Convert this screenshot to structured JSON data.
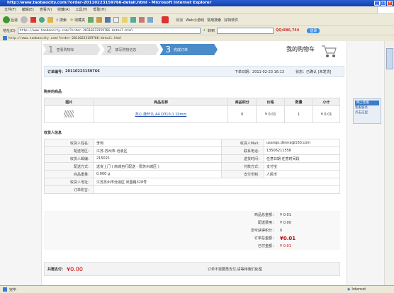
{
  "window": {
    "title": "http://www.taobaocity.com/?order-20110223159766-detail.html - Microsoft Internet Explorer"
  },
  "menu": [
    "文件(F)",
    "编辑(E)",
    "查看(V)",
    "收藏(A)",
    "工具(T)",
    "帮助(H)"
  ],
  "toolbar": {
    "back": "后退",
    "search": "搜索",
    "favorites": "收藏夹",
    "links": "链接",
    "web_game": "Web小游戏",
    "common_search": "常用搜索",
    "good_software": "好特软件",
    "login": "登录"
  },
  "address": {
    "label": "地址(D)",
    "url": "http://www.taobaocity.com/?order-20110223159766-detail.html",
    "go": "转到",
    "qq_count": "QQ:886,744"
  },
  "fav_url": "http://www.taobaocity.com/?order-20110223159766-detail.html",
  "steps": [
    {
      "n": "1",
      "label": "查看购物车"
    },
    {
      "n": "2",
      "label": "填写购物信息"
    },
    {
      "n": "3",
      "label": "完成订单"
    }
  ],
  "cart_title": "我的购物车",
  "order": {
    "number_label": "订单编号：",
    "number": "20110223159766",
    "date_label": "下单日期：",
    "date": "2011-02-23 16:13",
    "status_label": "状态：",
    "status": "已确认 [未发货]"
  },
  "goods": {
    "title": "购买的商品",
    "headers": [
      "图片",
      "商品名称",
      "商品积分",
      "价格",
      "数量",
      "小计"
    ],
    "rows": [
      {
        "name": "苏心 脉轩丸 A4 Q310-1 10mm",
        "points": "0",
        "price": "¥ 0.01",
        "qty": "1",
        "subtotal": "¥ 0.01"
      }
    ]
  },
  "receiver": {
    "title": "收货人信息",
    "left": [
      [
        "收货人姓名：",
        "李珂"
      ],
      [
        "配送地区：",
        "江苏-苏州市-沧浪区"
      ],
      [
        "收货人邮编：",
        "215021"
      ],
      [
        "配送方式：",
        "送货上门 ( 商城自行配送 - 限苏州城区 )"
      ],
      [
        "商品重量：",
        "0.000 g"
      ],
      [
        "收货人地址：",
        "江苏苏州市沧浪区 凤凰路328号"
      ],
      [
        "订单附言：",
        ""
      ]
    ],
    "right": [
      [
        "收货人Mail：",
        "usango.denna@163.com"
      ],
      [
        "联系电话：",
        "13506211558"
      ],
      [
        "送货时间：",
        "任意日期 任意时间段"
      ],
      [
        "付款方式：",
        "支付宝"
      ],
      [
        "支付币制：",
        "人民币"
      ]
    ]
  },
  "totals": [
    [
      "商品总金额：",
      "¥ 0.01"
    ],
    [
      "配送费用：",
      "¥ 0.00"
    ],
    [
      "您可获得积分：",
      "0"
    ],
    [
      "订单总金额：",
      "¥0.01"
    ],
    [
      "已付金额：",
      "¥ 0.01"
    ]
  ],
  "pay": {
    "label": "共需支付：",
    "amount": "¥0.00",
    "note": "订单不需要再支付,请等待我们处理"
  },
  "side": {
    "line1": "网上客服",
    "line2": "客服服务",
    "line3": "点击这里"
  },
  "status": {
    "left": "完毕",
    "right": "Internet"
  }
}
